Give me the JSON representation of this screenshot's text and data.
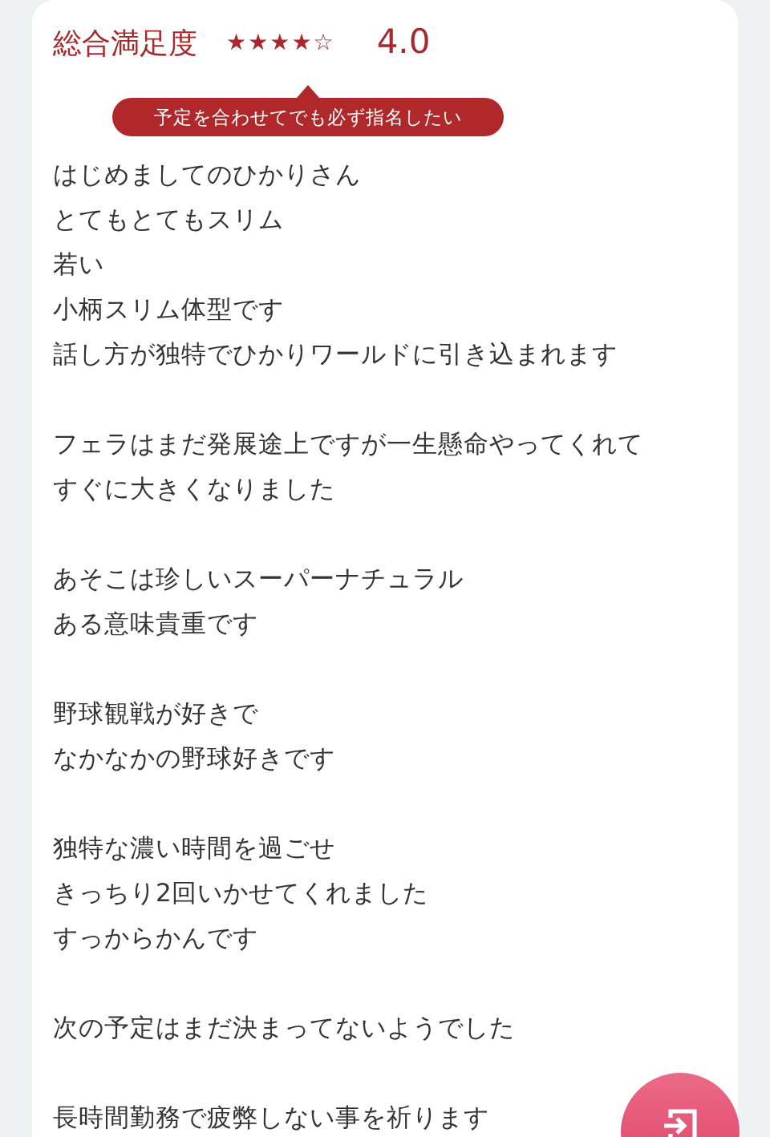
{
  "rating": {
    "label": "総合満足度",
    "stars": 4,
    "score": "4.0",
    "badge": "予定を合わせてでも必ず指名したい"
  },
  "paragraphs": [
    {
      "lines": [
        "はじめましてのひかりさん",
        "とてもとてもスリム",
        "若い",
        "小柄スリム体型です",
        "話し方が独特でひかりワールドに引き込まれます"
      ]
    },
    {
      "lines": [
        "フェラはまだ発展途上ですが一生懸命やってくれて",
        "すぐに大きくなりました"
      ]
    },
    {
      "lines": [
        "あそこは珍しいスーパーナチュラル",
        "ある意味貴重です"
      ]
    },
    {
      "lines": [
        "野球観戦が好きで",
        "なかなかの野球好きです"
      ]
    },
    {
      "lines": [
        "独特な濃い時間を過ごせ",
        "きっちり2回いかせてくれました",
        "すっからかんです"
      ]
    },
    {
      "lines": [
        "次の予定はまだ決まってないようでした"
      ]
    },
    {
      "lines": [
        "長時間勤務で疲弊しない事を祈ります"
      ]
    }
  ]
}
